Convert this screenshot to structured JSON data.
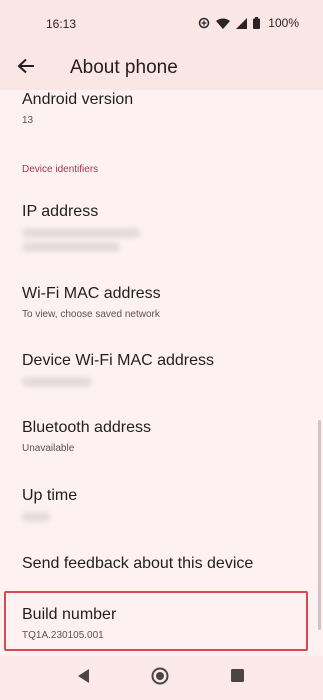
{
  "status_bar": {
    "time": "16:13",
    "battery": "100%"
  },
  "app_bar": {
    "title": "About phone"
  },
  "items": {
    "android_version": {
      "title": "Android version",
      "summary": "13"
    },
    "section_header": "Device identifiers",
    "ip_address": {
      "title": "IP address"
    },
    "wifi_mac": {
      "title": "Wi-Fi MAC address",
      "summary": "To view, choose saved network"
    },
    "device_wifi_mac": {
      "title": "Device Wi-Fi MAC address"
    },
    "bluetooth": {
      "title": "Bluetooth address",
      "summary": "Unavailable"
    },
    "up_time": {
      "title": "Up time"
    },
    "feedback": {
      "title": "Send feedback about this device"
    },
    "build_number": {
      "title": "Build number",
      "summary": "TQ1A.230105.001"
    }
  },
  "icons": [
    "data-saver-icon",
    "wifi-icon",
    "signal-icon",
    "battery-icon",
    "back-arrow-icon",
    "nav-back-icon",
    "nav-home-icon",
    "nav-recents-icon"
  ],
  "colors": {
    "accent": "#9a3b57",
    "highlight": "#d94a4f",
    "background": "#fdf1f1"
  }
}
